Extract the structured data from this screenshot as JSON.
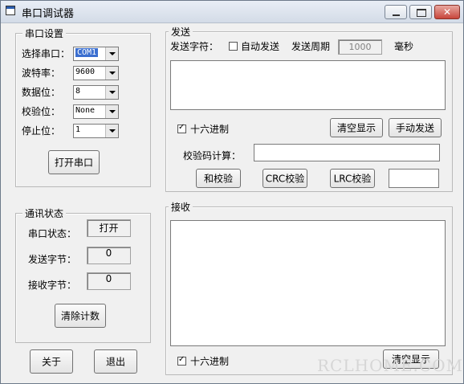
{
  "window": {
    "title": "串口调试器"
  },
  "serial_settings": {
    "title": "串口设置",
    "port": {
      "label": "选择串口：",
      "value": "COM1"
    },
    "baud": {
      "label": "波特率：",
      "value": "9600"
    },
    "data_bits": {
      "label": "数据位：",
      "value": "8"
    },
    "parity": {
      "label": "校验位：",
      "value": "None"
    },
    "stop_bits": {
      "label": "停止位：",
      "value": "1"
    },
    "open_button": "打开串口"
  },
  "status": {
    "title": "通讯状态",
    "port_state": {
      "label": "串口状态：",
      "value": "打开"
    },
    "sent_bytes": {
      "label": "发送字节：",
      "value": "0"
    },
    "recv_bytes": {
      "label": "接收字节：",
      "value": "0"
    },
    "clear_count_button": "清除计数"
  },
  "footer": {
    "about_button": "关于",
    "exit_button": "退出"
  },
  "send": {
    "title": "发送",
    "send_char_label": "发送字符：",
    "auto_send_label": "自动发送",
    "auto_send_checked": false,
    "period_label": "发送周期",
    "period_value": "1000",
    "unit_label": "毫秒",
    "hex_label": "十六进制",
    "hex_checked": true,
    "clear_button": "清空显示",
    "manual_send_button": "手动发送",
    "checksum_label": "校验码计算：",
    "checksum_input": "",
    "sum_button": "和校验",
    "crc_button": "CRC校验",
    "lrc_button": "LRC校验",
    "result_value": ""
  },
  "receive": {
    "title": "接收",
    "hex_label": "十六进制",
    "hex_checked": true,
    "clear_button": "清空显示"
  },
  "watermark": "RCLHOME.COM"
}
